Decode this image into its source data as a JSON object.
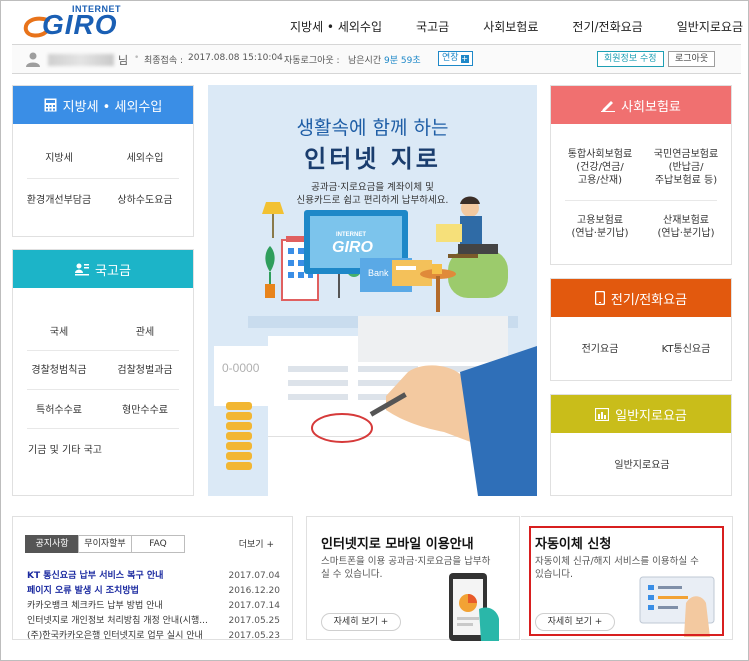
{
  "header": {
    "logo_small": "INTERNET",
    "logo_big": "GIRO",
    "nav": [
      "지방세 • 세외수입",
      "국고금",
      "사회보험료",
      "전기/전화요금",
      "일반지로요금"
    ]
  },
  "userbar": {
    "name_suffix": "님",
    "last_login_label": "최종접속 :",
    "last_login_value": "2017.08.08 15:10:04",
    "auto_logout_label": "자동로그아웃 :",
    "remaining_label": "남은시간",
    "remaining_value": "9분 59초",
    "extend_label": "연장",
    "extend_icon": "+",
    "edit_info_label": "회원정보 수정",
    "logout_label": "로그아웃"
  },
  "left_panels": [
    {
      "title": "지방세 • 세외수입",
      "icon": "calculator-icon",
      "color": "#3a8ee6",
      "items": [
        "지방세",
        "세외수입",
        "환경개선부담금",
        "상하수도요금"
      ]
    },
    {
      "title": "국고금",
      "icon": "people-icon",
      "color": "#1cb4c8",
      "items": [
        "국세",
        "관세",
        "경찰청범칙금",
        "검찰청벌과금",
        "특허수수료",
        "형만수수료",
        "기금 및 기타 국고"
      ]
    }
  ],
  "banner": {
    "title_line1": "생활속에 함께 하는",
    "title_line2": "인터넷 지로",
    "subtitle_line1": "공과금·지로요금을 계좌이체 및",
    "subtitle_line2": "신용카드로 쉽고 편리하게 납부하세요.",
    "screen_logo_small": "INTERNET",
    "screen_logo_big": "GIRO",
    "bank_label": "Bank",
    "bill_number": "0-0000"
  },
  "right_panels": [
    {
      "title": "사회보험료",
      "icon": "pen-icon",
      "color": "#f07070",
      "items": [
        "통합사회보험료\n(건강/연금/\n고용/산재)",
        "국민연금보험료\n(반납금/\n주납보험료 등)",
        "고용보험료\n(연납·분기납)",
        "산재보험료\n(연납·분기납)"
      ]
    },
    {
      "title": "전기/전화요금",
      "icon": "phone-icon",
      "color": "#e2590e",
      "items": [
        "전기요금",
        "KT통신요금"
      ]
    },
    {
      "title": "일반지로요금",
      "icon": "chart-icon",
      "color": "#c9bd1a",
      "items": [
        "일반지로요금"
      ]
    }
  ],
  "notices": {
    "tabs": [
      "공지사항",
      "무이자할부",
      "FAQ"
    ],
    "more_label": "더보기 +",
    "rows": [
      {
        "title": "KT 통신요금 납부 서비스 복구 안내",
        "date": "2017.07.04",
        "highlight": true
      },
      {
        "title": "페이지 오류 발생 시 조치방법",
        "date": "2016.12.20",
        "highlight": true
      },
      {
        "title": "카카오뱅크 체크카드 납부 방법 안내",
        "date": "2017.07.14",
        "highlight": false
      },
      {
        "title": "인터넷지로 개인정보 처리방침 개정 안내(시행...",
        "date": "2017.05.25",
        "highlight": false
      },
      {
        "title": "(주)한국카카오은행 인터넷지로 업무 실시 안내",
        "date": "2017.05.23",
        "highlight": false
      }
    ]
  },
  "mobile_promo": {
    "title": "인터넷지로 모바일 이용안내",
    "desc": "스마트폰을 이용 공과금·지로요금을 납부하실 수 있습니다.",
    "button": "자세히 보기"
  },
  "autopay_promo": {
    "title": "자동이체 신청",
    "desc": "자동이체 신규/해지 서비스를 이용하실 수 있습니다.",
    "button": "자세히 보기"
  },
  "colors": {
    "brand": "#1a5fb4",
    "highlight_frame": "#d81f1f"
  }
}
